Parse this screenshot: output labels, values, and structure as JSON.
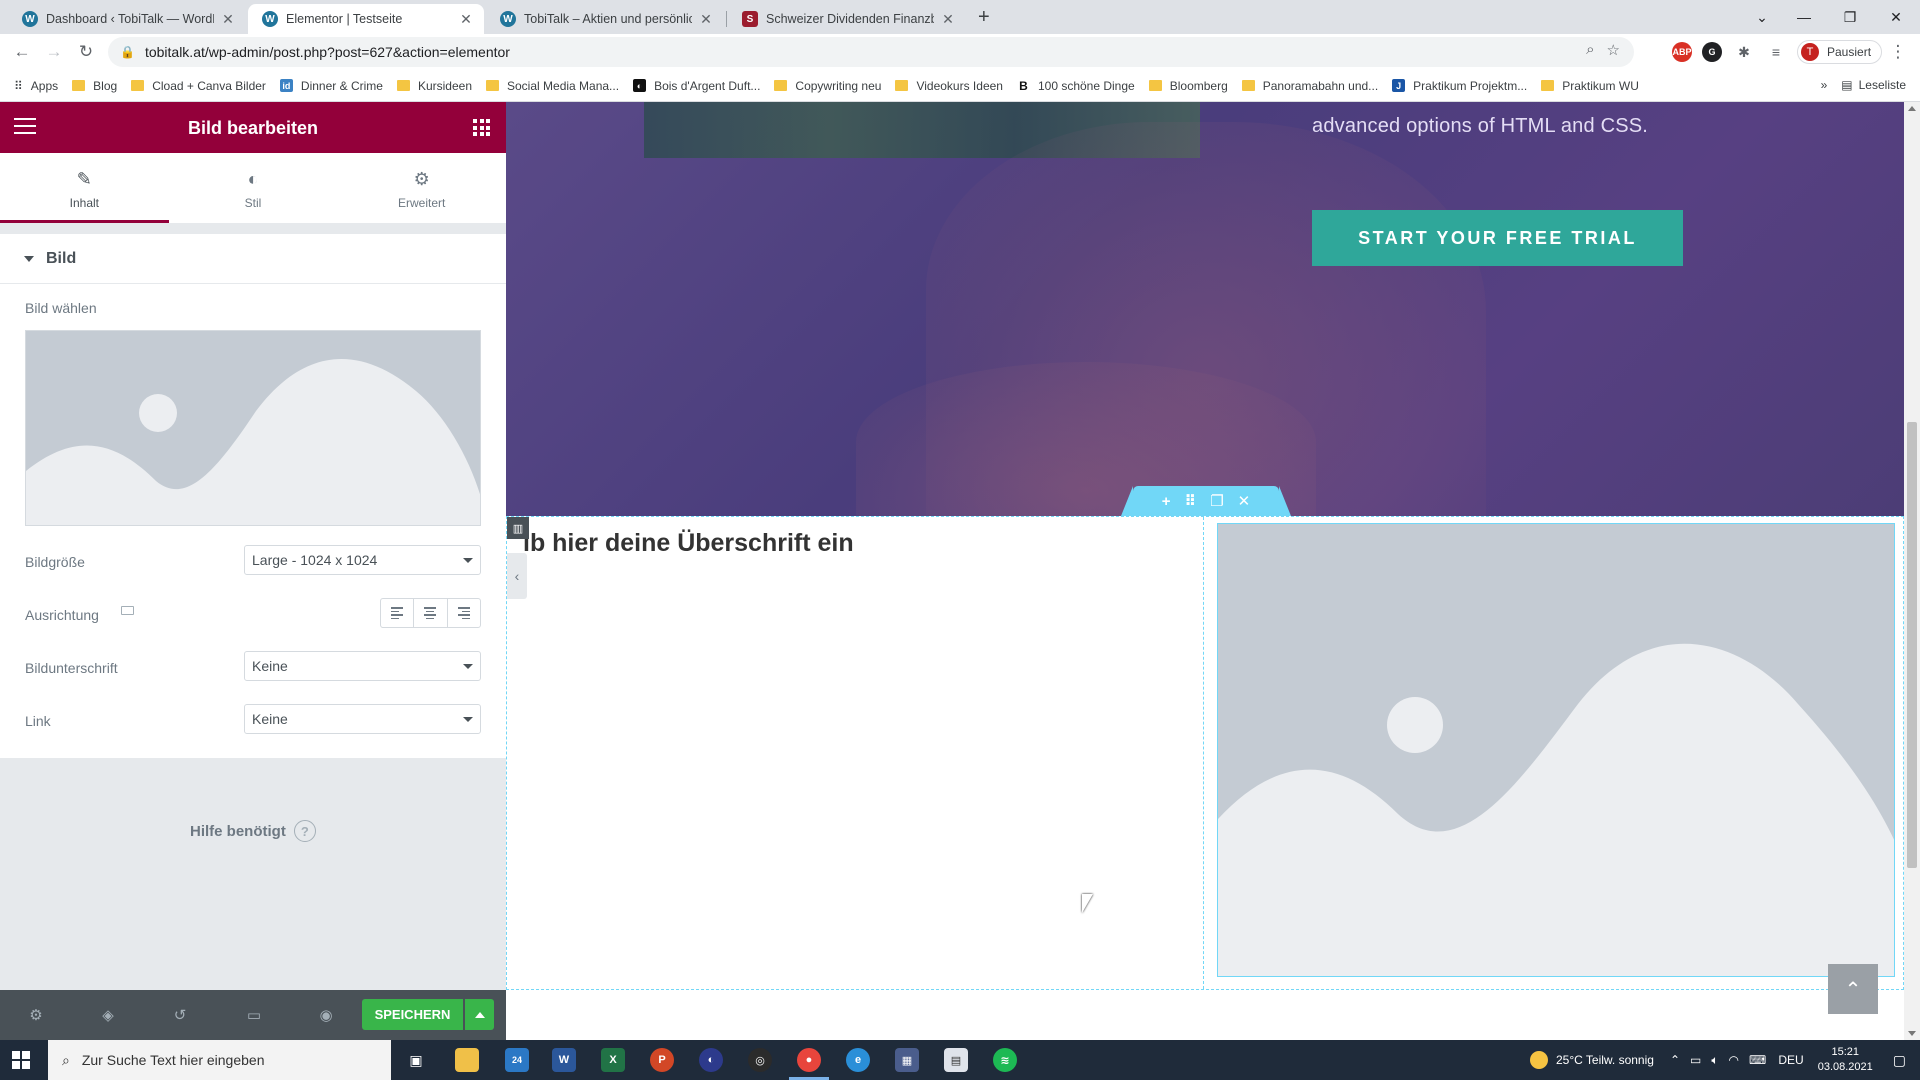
{
  "browser": {
    "tabs": [
      {
        "title": "Dashboard ‹ TobiTalk — WordPre",
        "favicon": "wordpress-icon"
      },
      {
        "title": "Elementor | Testseite",
        "favicon": "wordpress-icon",
        "active": true
      },
      {
        "title": "TobiTalk – Aktien und persönliche",
        "favicon": "wordpress-icon"
      },
      {
        "title": "Schweizer Dividenden Finanzblo",
        "favicon": "blog-icon"
      }
    ],
    "url": "tobitalk.at/wp-admin/post.php?post=627&action=elementor",
    "profile_label": "Pausiert",
    "profile_initial": "T",
    "bookmarks": [
      {
        "label": "Apps",
        "icon": "apps-grid-icon"
      },
      {
        "label": "Blog",
        "icon": "folder-icon"
      },
      {
        "label": "Cload + Canva Bilder",
        "icon": "folder-icon"
      },
      {
        "label": "Dinner & Crime",
        "icon": "site-icon"
      },
      {
        "label": "Kursideen",
        "icon": "folder-icon"
      },
      {
        "label": "Social Media Mana...",
        "icon": "folder-icon"
      },
      {
        "label": "Bois d'Argent Duft...",
        "icon": "site-icon"
      },
      {
        "label": "Copywriting neu",
        "icon": "folder-icon"
      },
      {
        "label": "Videokurs Ideen",
        "icon": "folder-icon"
      },
      {
        "label": "100 schöne Dinge",
        "icon": "site-icon"
      },
      {
        "label": "Bloomberg",
        "icon": "folder-icon"
      },
      {
        "label": "Panoramabahn und...",
        "icon": "folder-icon"
      },
      {
        "label": "Praktikum Projektm...",
        "icon": "site-icon"
      },
      {
        "label": "Praktikum WU",
        "icon": "folder-icon"
      }
    ],
    "reading_list": "Leseliste"
  },
  "panel": {
    "title": "Bild bearbeiten",
    "tabs": [
      {
        "label": "Inhalt",
        "icon": "pencil-icon"
      },
      {
        "label": "Stil",
        "icon": "contrast-icon"
      },
      {
        "label": "Erweitert",
        "icon": "gear-icon"
      }
    ],
    "section_title": "Bild",
    "choose_image_label": "Bild wählen",
    "image_size_label": "Bildgröße",
    "image_size_value": "Large - 1024 x 1024",
    "alignment_label": "Ausrichtung",
    "caption_label": "Bildunterschrift",
    "caption_value": "Keine",
    "link_label": "Link",
    "link_value": "Keine",
    "help_label": "Hilfe benötigt",
    "save_label": "SPEICHERN"
  },
  "preview": {
    "hero_text": "advanced options of HTML and CSS.",
    "cta_label": "START YOUR FREE TRIAL",
    "heading": "ib hier deine Überschrift ein"
  },
  "taskbar": {
    "search_placeholder": "Zur Suche Text hier eingeben",
    "weather": "25°C  Teilw. sonnig",
    "language": "DEU",
    "time": "15:21",
    "date": "03.08.2021",
    "mail_badge": "24"
  },
  "colors": {
    "elementor_header": "#93003a",
    "cta": "#2fa79a",
    "save": "#39b54a",
    "section_outline": "#71d7f7"
  }
}
